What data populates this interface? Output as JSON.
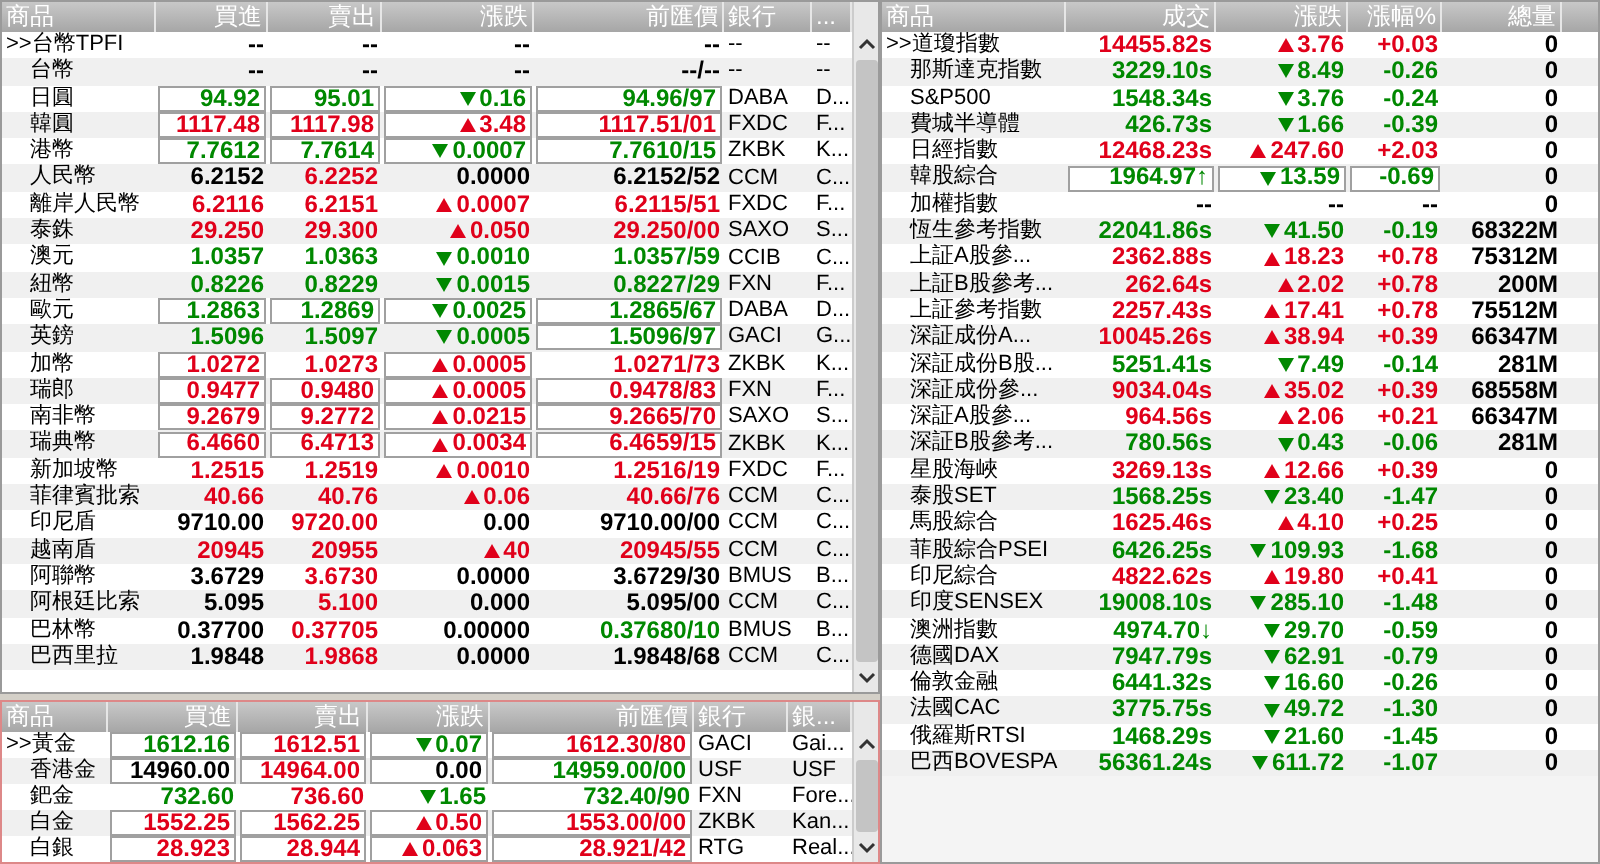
{
  "fx_table": {
    "columns": [
      "商品",
      "買進",
      "賣出",
      "漲跌",
      "前匯價",
      "銀行",
      "..."
    ],
    "rows": [
      {
        "marker": ">>",
        "name": "台幣TPFI",
        "quotes": [
          {
            "text": "--",
            "color": "#000000",
            "boxed": false
          },
          {
            "text": "--",
            "color": "#000000",
            "boxed": false
          },
          {
            "text": "--",
            "color": "#000000",
            "boxed": false,
            "kind": "none"
          },
          {
            "text": "--",
            "color": "#000000",
            "boxed": false
          }
        ],
        "bank": "--",
        "column_7": "--"
      },
      {
        "name": "台幣",
        "quotes": [
          {
            "text": "--",
            "color": "#000000",
            "boxed": false
          },
          {
            "text": "--",
            "color": "#000000",
            "boxed": false
          },
          {
            "text": "--",
            "color": "#000000",
            "boxed": false,
            "kind": "none"
          },
          {
            "text": "--/--",
            "color": "#000000",
            "boxed": false
          }
        ],
        "bank": "--",
        "column_7": "--"
      },
      {
        "name": "日圓",
        "quotes": [
          {
            "text": "94.92",
            "color": "#008800",
            "boxed": true
          },
          {
            "text": "95.01",
            "color": "#008800",
            "boxed": true
          },
          {
            "text": "0.16",
            "color": "#008800",
            "boxed": true,
            "kind": "down"
          },
          {
            "text": "94.96/97",
            "color": "#008800",
            "boxed": true
          }
        ],
        "bank": "DABA",
        "column_7": "D..."
      },
      {
        "name": "韓圓",
        "quotes": [
          {
            "text": "1117.48",
            "color": "#e0001a",
            "boxed": true
          },
          {
            "text": "1117.98",
            "color": "#e0001a",
            "boxed": true
          },
          {
            "text": "3.48",
            "color": "#e0001a",
            "boxed": true,
            "kind": "up"
          },
          {
            "text": "1117.51/01",
            "color": "#e0001a",
            "boxed": true
          }
        ],
        "bank": "FXDC",
        "column_7": "F..."
      },
      {
        "name": "港幣",
        "quotes": [
          {
            "text": "7.7612",
            "color": "#008800",
            "boxed": true
          },
          {
            "text": "7.7614",
            "color": "#008800",
            "boxed": true
          },
          {
            "text": "0.0007",
            "color": "#008800",
            "boxed": true,
            "kind": "down"
          },
          {
            "text": "7.7610/15",
            "color": "#008800",
            "boxed": true
          }
        ],
        "bank": "ZKBK",
        "column_7": "K..."
      },
      {
        "name": "人民幣",
        "quotes": [
          {
            "text": "6.2152",
            "color": "#000000",
            "boxed": false
          },
          {
            "text": "6.2252",
            "color": "#e0001a",
            "boxed": false
          },
          {
            "text": "0.0000",
            "color": "#000000",
            "boxed": false,
            "kind": "none"
          },
          {
            "text": "6.2152/52",
            "color": "#000000",
            "boxed": false
          }
        ],
        "bank": "CCM",
        "column_7": "C..."
      },
      {
        "name": "離岸人民幣",
        "quotes": [
          {
            "text": "6.2116",
            "color": "#e0001a",
            "boxed": false
          },
          {
            "text": "6.2151",
            "color": "#e0001a",
            "boxed": false
          },
          {
            "text": "0.0007",
            "color": "#e0001a",
            "boxed": false,
            "kind": "up"
          },
          {
            "text": "6.2115/51",
            "color": "#e0001a",
            "boxed": false
          }
        ],
        "bank": "FXDC",
        "column_7": "F..."
      },
      {
        "name": "泰銖",
        "quotes": [
          {
            "text": "29.250",
            "color": "#e0001a",
            "boxed": false
          },
          {
            "text": "29.300",
            "color": "#e0001a",
            "boxed": false
          },
          {
            "text": "0.050",
            "color": "#e0001a",
            "boxed": false,
            "kind": "up"
          },
          {
            "text": "29.250/00",
            "color": "#e0001a",
            "boxed": false
          }
        ],
        "bank": "SAXO",
        "column_7": "S..."
      },
      {
        "name": "澳元",
        "quotes": [
          {
            "text": "1.0357",
            "color": "#008800",
            "boxed": false
          },
          {
            "text": "1.0363",
            "color": "#008800",
            "boxed": false
          },
          {
            "text": "0.0010",
            "color": "#008800",
            "boxed": false,
            "kind": "down"
          },
          {
            "text": "1.0357/59",
            "color": "#008800",
            "boxed": false
          }
        ],
        "bank": "CCIB",
        "column_7": "C..."
      },
      {
        "name": "紐幣",
        "quotes": [
          {
            "text": "0.8226",
            "color": "#008800",
            "boxed": false
          },
          {
            "text": "0.8229",
            "color": "#008800",
            "boxed": false
          },
          {
            "text": "0.0015",
            "color": "#008800",
            "boxed": false,
            "kind": "down"
          },
          {
            "text": "0.8227/29",
            "color": "#008800",
            "boxed": false
          }
        ],
        "bank": "FXN",
        "column_7": "F..."
      },
      {
        "name": "歐元",
        "quotes": [
          {
            "text": "1.2863",
            "color": "#008800",
            "boxed": true
          },
          {
            "text": "1.2869",
            "color": "#008800",
            "boxed": true
          },
          {
            "text": "0.0025",
            "color": "#008800",
            "boxed": true,
            "kind": "down"
          },
          {
            "text": "1.2865/67",
            "color": "#008800",
            "boxed": true
          }
        ],
        "bank": "DABA",
        "column_7": "D..."
      },
      {
        "name": "英鎊",
        "quotes": [
          {
            "text": "1.5096",
            "color": "#008800",
            "boxed": false
          },
          {
            "text": "1.5097",
            "color": "#008800",
            "boxed": false
          },
          {
            "text": "0.0005",
            "color": "#008800",
            "boxed": false,
            "kind": "down"
          },
          {
            "text": "1.5096/97",
            "color": "#008800",
            "boxed": true
          }
        ],
        "bank": "GACI",
        "column_7": "G..."
      },
      {
        "name": "加幣",
        "quotes": [
          {
            "text": "1.0272",
            "color": "#e0001a",
            "boxed": true
          },
          {
            "text": "1.0273",
            "color": "#e0001a",
            "boxed": false
          },
          {
            "text": "0.0005",
            "color": "#e0001a",
            "boxed": true,
            "kind": "up"
          },
          {
            "text": "1.0271/73",
            "color": "#e0001a",
            "boxed": false
          }
        ],
        "bank": "ZKBK",
        "column_7": "K..."
      },
      {
        "name": "瑞郎",
        "quotes": [
          {
            "text": "0.9477",
            "color": "#e0001a",
            "boxed": true
          },
          {
            "text": "0.9480",
            "color": "#e0001a",
            "boxed": true
          },
          {
            "text": "0.0005",
            "color": "#e0001a",
            "boxed": true,
            "kind": "up"
          },
          {
            "text": "0.9478/83",
            "color": "#e0001a",
            "boxed": true
          }
        ],
        "bank": "FXN",
        "column_7": "F..."
      },
      {
        "name": "南非幣",
        "quotes": [
          {
            "text": "9.2679",
            "color": "#e0001a",
            "boxed": true
          },
          {
            "text": "9.2772",
            "color": "#e0001a",
            "boxed": true
          },
          {
            "text": "0.0215",
            "color": "#e0001a",
            "boxed": true,
            "kind": "up"
          },
          {
            "text": "9.2665/70",
            "color": "#e0001a",
            "boxed": true
          }
        ],
        "bank": "SAXO",
        "column_7": "S..."
      },
      {
        "name": "瑞典幣",
        "quotes": [
          {
            "text": "6.4660",
            "color": "#e0001a",
            "boxed": true
          },
          {
            "text": "6.4713",
            "color": "#e0001a",
            "boxed": true
          },
          {
            "text": "0.0034",
            "color": "#e0001a",
            "boxed": true,
            "kind": "up"
          },
          {
            "text": "6.4659/15",
            "color": "#e0001a",
            "boxed": true
          }
        ],
        "bank": "ZKBK",
        "column_7": "K..."
      },
      {
        "name": "新加坡幣",
        "quotes": [
          {
            "text": "1.2515",
            "color": "#e0001a",
            "boxed": false
          },
          {
            "text": "1.2519",
            "color": "#e0001a",
            "boxed": false
          },
          {
            "text": "0.0010",
            "color": "#e0001a",
            "boxed": false,
            "kind": "up"
          },
          {
            "text": "1.2516/19",
            "color": "#e0001a",
            "boxed": false
          }
        ],
        "bank": "FXDC",
        "column_7": "F..."
      },
      {
        "name": "菲律賓批索",
        "quotes": [
          {
            "text": "40.66",
            "color": "#e0001a",
            "boxed": false
          },
          {
            "text": "40.76",
            "color": "#e0001a",
            "boxed": false
          },
          {
            "text": "0.06",
            "color": "#e0001a",
            "boxed": false,
            "kind": "up"
          },
          {
            "text": "40.66/76",
            "color": "#e0001a",
            "boxed": false
          }
        ],
        "bank": "CCM",
        "column_7": "C..."
      },
      {
        "name": "印尼盾",
        "quotes": [
          {
            "text": "9710.00",
            "color": "#000000",
            "boxed": false
          },
          {
            "text": "9720.00",
            "color": "#e0001a",
            "boxed": false
          },
          {
            "text": "0.00",
            "color": "#000000",
            "boxed": false,
            "kind": "none"
          },
          {
            "text": "9710.00/00",
            "color": "#000000",
            "boxed": false
          }
        ],
        "bank": "CCM",
        "column_7": "C..."
      },
      {
        "name": "越南盾",
        "quotes": [
          {
            "text": "20945",
            "color": "#e0001a",
            "boxed": false
          },
          {
            "text": "20955",
            "color": "#e0001a",
            "boxed": false
          },
          {
            "text": "40",
            "color": "#e0001a",
            "boxed": false,
            "kind": "up"
          },
          {
            "text": "20945/55",
            "color": "#e0001a",
            "boxed": false
          }
        ],
        "bank": "CCM",
        "column_7": "C..."
      },
      {
        "name": "阿聯幣",
        "quotes": [
          {
            "text": "3.6729",
            "color": "#000000",
            "boxed": false
          },
          {
            "text": "3.6730",
            "color": "#e0001a",
            "boxed": false
          },
          {
            "text": "0.0000",
            "color": "#000000",
            "boxed": false,
            "kind": "none"
          },
          {
            "text": "3.6729/30",
            "color": "#000000",
            "boxed": false
          }
        ],
        "bank": "BMUS",
        "column_7": "B..."
      },
      {
        "name": "阿根廷比索",
        "quotes": [
          {
            "text": "5.095",
            "color": "#000000",
            "boxed": false
          },
          {
            "text": "5.100",
            "color": "#e0001a",
            "boxed": false
          },
          {
            "text": "0.000",
            "color": "#000000",
            "boxed": false,
            "kind": "none"
          },
          {
            "text": "5.095/00",
            "color": "#000000",
            "boxed": false
          }
        ],
        "bank": "CCM",
        "column_7": "C..."
      },
      {
        "name": "巴林幣",
        "quotes": [
          {
            "text": "0.37700",
            "color": "#000000",
            "boxed": false
          },
          {
            "text": "0.37705",
            "color": "#e0001a",
            "boxed": false
          },
          {
            "text": "0.00000",
            "color": "#000000",
            "boxed": false,
            "kind": "none"
          },
          {
            "text": "0.37680/10",
            "color": "#008800",
            "boxed": false
          }
        ],
        "bank": "BMUS",
        "column_7": "B..."
      },
      {
        "name": "巴西里拉",
        "quotes": [
          {
            "text": "1.9848",
            "color": "#000000",
            "boxed": false
          },
          {
            "text": "1.9868",
            "color": "#e0001a",
            "boxed": false
          },
          {
            "text": "0.0000",
            "color": "#000000",
            "boxed": false,
            "kind": "none"
          },
          {
            "text": "1.9848/68",
            "color": "#000000",
            "boxed": false
          }
        ],
        "bank": "CCM",
        "column_7": "C..."
      }
    ]
  },
  "metals_table": {
    "columns": [
      "商品",
      "買進",
      "賣出",
      "漲跌",
      "前匯價",
      "銀行",
      "銀..."
    ],
    "rows": [
      {
        "marker": ">>",
        "name": "黃金",
        "quotes": [
          {
            "text": "1612.16",
            "color": "#008800",
            "boxed": true
          },
          {
            "text": "1612.51",
            "color": "#e0001a",
            "boxed": true
          },
          {
            "text": "0.07",
            "color": "#008800",
            "boxed": true,
            "kind": "down"
          },
          {
            "text": "1612.30/80",
            "color": "#e0001a",
            "boxed": true
          }
        ],
        "bank": "GACI",
        "column_7": "Gai..."
      },
      {
        "name": "香港金",
        "quotes": [
          {
            "text": "14960.00",
            "color": "#000000",
            "boxed": true
          },
          {
            "text": "14964.00",
            "color": "#e0001a",
            "boxed": true
          },
          {
            "text": "0.00",
            "color": "#000000",
            "boxed": true,
            "kind": "none"
          },
          {
            "text": "14959.00/00",
            "color": "#008800",
            "boxed": true
          }
        ],
        "bank": "USF",
        "column_7": "USF"
      },
      {
        "name": "鈀金",
        "quotes": [
          {
            "text": "732.60",
            "color": "#008800",
            "boxed": false
          },
          {
            "text": "736.60",
            "color": "#e0001a",
            "boxed": false
          },
          {
            "text": "1.65",
            "color": "#008800",
            "boxed": false,
            "kind": "down"
          },
          {
            "text": "732.40/90",
            "color": "#008800",
            "boxed": false
          }
        ],
        "bank": "FXN",
        "column_7": "Fore..."
      },
      {
        "name": "白金",
        "quotes": [
          {
            "text": "1552.25",
            "color": "#e0001a",
            "boxed": true
          },
          {
            "text": "1562.25",
            "color": "#e0001a",
            "boxed": true
          },
          {
            "text": "0.50",
            "color": "#e0001a",
            "boxed": true,
            "kind": "up"
          },
          {
            "text": "1553.00/00",
            "color": "#e0001a",
            "boxed": true
          }
        ],
        "bank": "ZKBK",
        "column_7": "Kan..."
      },
      {
        "name": "白銀",
        "quotes": [
          {
            "text": "28.923",
            "color": "#e0001a",
            "boxed": true
          },
          {
            "text": "28.944",
            "color": "#e0001a",
            "boxed": true
          },
          {
            "text": "0.063",
            "color": "#e0001a",
            "boxed": true,
            "kind": "up"
          },
          {
            "text": "28.921/42",
            "color": "#e0001a",
            "boxed": true
          }
        ],
        "bank": "RTG",
        "column_7": "Real..."
      }
    ]
  },
  "index_table": {
    "columns": [
      "商品",
      "成交",
      "漲跌",
      "漲幅%",
      "總量"
    ],
    "rows": [
      {
        "marker": ">>",
        "name": "道瓊指數",
        "price": "14455.82s",
        "change": "3.76",
        "percent": "+0.03",
        "volume": "0",
        "color": "#e0001a",
        "kind": "up",
        "boxed": false
      },
      {
        "name": "那斯達克指數",
        "price": "3229.10s",
        "change": "8.49",
        "percent": "-0.26",
        "volume": "0",
        "color": "#008800",
        "kind": "down",
        "boxed": false
      },
      {
        "name": "S&P500",
        "price": "1548.34s",
        "change": "3.76",
        "percent": "-0.24",
        "volume": "0",
        "color": "#008800",
        "kind": "down",
        "boxed": false
      },
      {
        "name": "費城半導體",
        "price": "426.73s",
        "change": "1.66",
        "percent": "-0.39",
        "volume": "0",
        "color": "#008800",
        "kind": "down",
        "boxed": false
      },
      {
        "name": "日經指數",
        "price": "12468.23s",
        "change": "247.60",
        "percent": "+2.03",
        "volume": "0",
        "color": "#e0001a",
        "kind": "up",
        "boxed": false
      },
      {
        "name": "韓股綜合",
        "price": "1964.97↑",
        "change": "13.59",
        "percent": "-0.69",
        "volume": "0",
        "color": "#008800",
        "kind": "down",
        "boxed": true
      },
      {
        "name": "加權指數",
        "price": "--",
        "change": "--",
        "percent": "--",
        "volume": "0",
        "color": "#000000",
        "kind": "none",
        "boxed": false
      },
      {
        "name": "恆生參考指數",
        "price": "22041.86s",
        "change": "41.50",
        "percent": "-0.19",
        "volume": "68322M",
        "color": "#008800",
        "kind": "down",
        "boxed": false
      },
      {
        "name": "上証A股參...",
        "price": "2362.88s",
        "change": "18.23",
        "percent": "+0.78",
        "volume": "75312M",
        "color": "#e0001a",
        "kind": "up",
        "boxed": false
      },
      {
        "name": "上証B股參考...",
        "price": "262.64s",
        "change": "2.02",
        "percent": "+0.78",
        "volume": "200M",
        "color": "#e0001a",
        "kind": "up",
        "boxed": false
      },
      {
        "name": "上証參考指數",
        "price": "2257.43s",
        "change": "17.41",
        "percent": "+0.78",
        "volume": "75512M",
        "color": "#e0001a",
        "kind": "up",
        "boxed": false
      },
      {
        "name": "深証成份A...",
        "price": "10045.26s",
        "change": "38.94",
        "percent": "+0.39",
        "volume": "66347M",
        "color": "#e0001a",
        "kind": "up",
        "boxed": false
      },
      {
        "name": "深証成份B股...",
        "price": "5251.41s",
        "change": "7.49",
        "percent": "-0.14",
        "volume": "281M",
        "color": "#008800",
        "kind": "down",
        "boxed": false
      },
      {
        "name": "深証成份參...",
        "price": "9034.04s",
        "change": "35.02",
        "percent": "+0.39",
        "volume": "68558M",
        "color": "#e0001a",
        "kind": "up",
        "boxed": false
      },
      {
        "name": "深証A股參...",
        "price": "964.56s",
        "change": "2.06",
        "percent": "+0.21",
        "volume": "66347M",
        "color": "#e0001a",
        "kind": "up",
        "boxed": false
      },
      {
        "name": "深証B股參考...",
        "price": "780.56s",
        "change": "0.43",
        "percent": "-0.06",
        "volume": "281M",
        "color": "#008800",
        "kind": "down",
        "boxed": false
      },
      {
        "name": "星股海峽",
        "price": "3269.13s",
        "change": "12.66",
        "percent": "+0.39",
        "volume": "0",
        "color": "#e0001a",
        "kind": "up",
        "boxed": false
      },
      {
        "name": "泰股SET",
        "price": "1568.25s",
        "change": "23.40",
        "percent": "-1.47",
        "volume": "0",
        "color": "#008800",
        "kind": "down",
        "boxed": false
      },
      {
        "name": "馬股綜合",
        "price": "1625.46s",
        "change": "4.10",
        "percent": "+0.25",
        "volume": "0",
        "color": "#e0001a",
        "kind": "up",
        "boxed": false
      },
      {
        "name": "菲股綜合PSEI",
        "price": "6426.25s",
        "change": "109.93",
        "percent": "-1.68",
        "volume": "0",
        "color": "#008800",
        "kind": "down",
        "boxed": false
      },
      {
        "name": "印尼綜合",
        "price": "4822.62s",
        "change": "19.80",
        "percent": "+0.41",
        "volume": "0",
        "color": "#e0001a",
        "kind": "up",
        "boxed": false
      },
      {
        "name": "印度SENSEX",
        "price": "19008.10s",
        "change": "285.10",
        "percent": "-1.48",
        "volume": "0",
        "color": "#008800",
        "kind": "down",
        "boxed": false
      },
      {
        "name": "澳洲指數",
        "price": "4974.70↓",
        "change": "29.70",
        "percent": "-0.59",
        "volume": "0",
        "color": "#008800",
        "kind": "down",
        "boxed": false
      },
      {
        "name": "德國DAX",
        "price": "7947.79s",
        "change": "62.91",
        "percent": "-0.79",
        "volume": "0",
        "color": "#008800",
        "kind": "down",
        "boxed": false
      },
      {
        "name": "倫敦金融",
        "price": "6441.32s",
        "change": "16.60",
        "percent": "-0.26",
        "volume": "0",
        "color": "#008800",
        "kind": "down",
        "boxed": false
      },
      {
        "name": "法國CAC",
        "price": "3775.75s",
        "change": "49.72",
        "percent": "-1.30",
        "volume": "0",
        "color": "#008800",
        "kind": "down",
        "boxed": false
      },
      {
        "name": "俄羅斯RTSI",
        "price": "1468.29s",
        "change": "21.60",
        "percent": "-1.45",
        "volume": "0",
        "color": "#008800",
        "kind": "down",
        "boxed": false
      },
      {
        "name": "巴西BOVESPA",
        "price": "56361.24s",
        "change": "611.72",
        "percent": "-1.07",
        "volume": "0",
        "color": "#008800",
        "kind": "down",
        "boxed": false
      }
    ]
  }
}
